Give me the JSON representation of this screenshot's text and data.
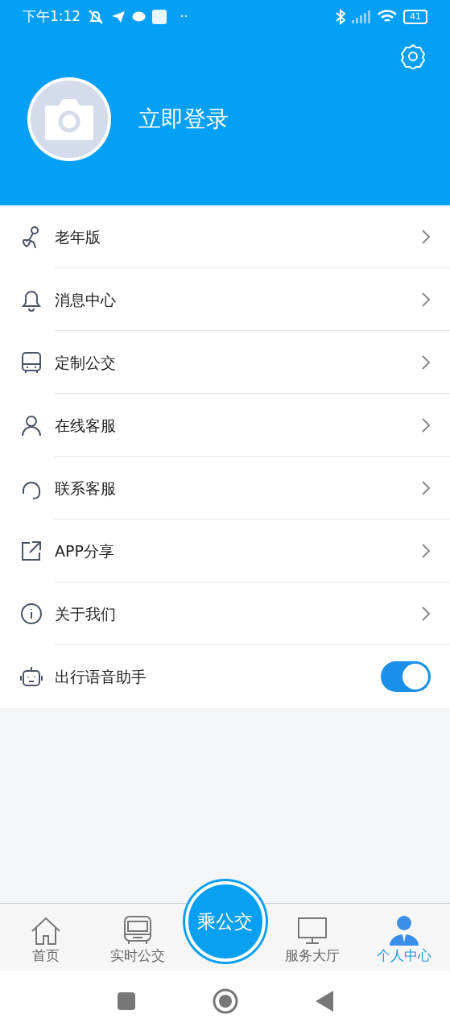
{
  "status_bar": {
    "time": "下午1:12",
    "more": "··",
    "battery": "41"
  },
  "header": {
    "login": "立即登录"
  },
  "menu": [
    {
      "label": "老年版",
      "kind": "link"
    },
    {
      "label": "消息中心",
      "kind": "link"
    },
    {
      "label": "定制公交",
      "kind": "link"
    },
    {
      "label": "在线客服",
      "kind": "link"
    },
    {
      "label": "联系客服",
      "kind": "link"
    },
    {
      "label": "APP分享",
      "kind": "link"
    },
    {
      "label": "关于我们",
      "kind": "link"
    },
    {
      "label": "出行语音助手",
      "kind": "toggle",
      "on": true
    }
  ],
  "tabs": [
    {
      "label": "首页",
      "kind": "tab",
      "selected": false
    },
    {
      "label": "实时公交",
      "kind": "tab",
      "selected": false
    },
    {
      "label": "乘公交",
      "kind": "center"
    },
    {
      "label": "服务大厅",
      "kind": "tab",
      "selected": false
    },
    {
      "label": "个人中心",
      "kind": "tab",
      "selected": true
    }
  ]
}
